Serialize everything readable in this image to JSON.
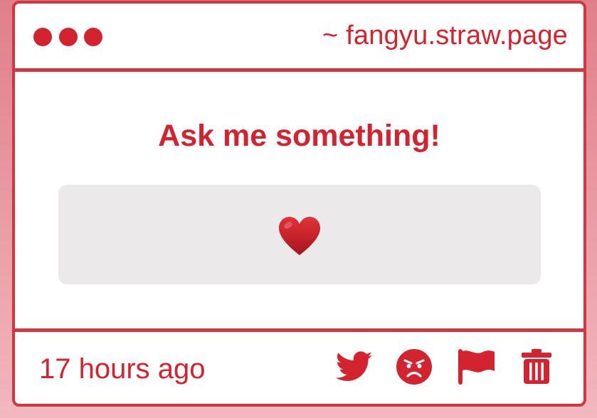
{
  "window": {
    "site_url": "~ fangyu.straw.page"
  },
  "main": {
    "prompt_text": "Ask me something!",
    "answer_emoji": "heart-icon"
  },
  "footer": {
    "timestamp": "17 hours ago",
    "actions": [
      {
        "icon": "twitter-icon"
      },
      {
        "icon": "angry-face-icon"
      },
      {
        "icon": "flag-icon"
      },
      {
        "icon": "trash-icon"
      }
    ]
  },
  "colors": {
    "accent": "#d2232e",
    "border": "#d2363f",
    "answer_box_bg": "#ece9ea",
    "background_top": "#e07f89",
    "background_bottom": "#f2b7bf"
  }
}
